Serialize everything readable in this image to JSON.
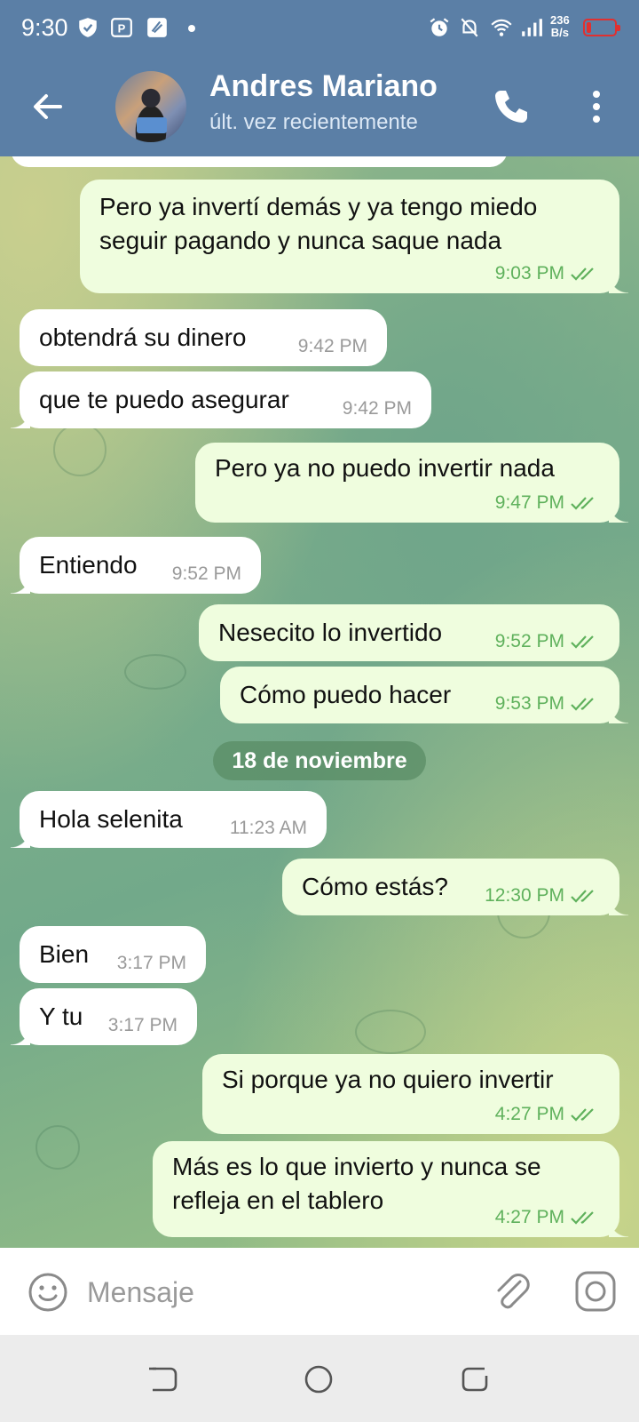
{
  "status_bar": {
    "time": "9:30",
    "net_speed_value": "236",
    "net_speed_unit": "B/s",
    "battery_color": "#e03030"
  },
  "header": {
    "contact_name": "Andres Mariano",
    "contact_status": "últ. vez recientemente",
    "background_color": "#5b7fa6"
  },
  "messages": [
    {
      "direction": "in",
      "text": "obtendrá su dinero",
      "time": "9:42 PM"
    },
    {
      "direction": "in",
      "text": "que te puedo asegurar",
      "time": "9:42 PM"
    },
    {
      "direction": "out",
      "text": "Pero ya invertí demás y ya tengo miedo seguir pagando y nunca saque nada",
      "time": "9:03 PM",
      "status": "read"
    },
    {
      "direction": "out",
      "text": "Pero ya no puedo invertir nada",
      "time": "9:47 PM",
      "status": "read"
    },
    {
      "direction": "in",
      "text": "Entiendo",
      "time": "9:52 PM"
    },
    {
      "direction": "out",
      "text": "Nesecito lo invertido",
      "time": "9:52 PM",
      "status": "read"
    },
    {
      "direction": "out",
      "text": "Cómo puedo hacer",
      "time": "9:53 PM",
      "status": "read"
    },
    {
      "direction": "in",
      "text": "Hola selenita",
      "time": "11:23 AM"
    },
    {
      "direction": "out",
      "text": "Cómo estás?",
      "time": "12:30 PM",
      "status": "read"
    },
    {
      "direction": "in",
      "text": "Bien",
      "time": "3:17 PM"
    },
    {
      "direction": "in",
      "text": "Y tu",
      "time": "3:17 PM"
    },
    {
      "direction": "out",
      "text": "Si porque ya no quiero invertir",
      "time": "4:27 PM",
      "status": "read"
    },
    {
      "direction": "out",
      "text": "Más es lo que invierto y nunca se refleja en el tablero",
      "time": "4:27 PM",
      "status": "read"
    }
  ],
  "date_separator": "18 de noviembre",
  "composer": {
    "placeholder": "Mensaje",
    "value": ""
  },
  "colors": {
    "incoming_bubble": "#ffffff",
    "outgoing_bubble": "#effdde",
    "outgoing_time": "#5fb15c",
    "incoming_time": "#9a9a9a"
  },
  "icons": {
    "header": [
      "back-arrow-icon",
      "phone-icon",
      "more-vertical-icon"
    ],
    "composer": [
      "emoji-icon",
      "attach-icon",
      "camera-icon"
    ],
    "navbar": [
      "nav-back-icon",
      "nav-home-icon",
      "nav-recent-icon"
    ]
  }
}
